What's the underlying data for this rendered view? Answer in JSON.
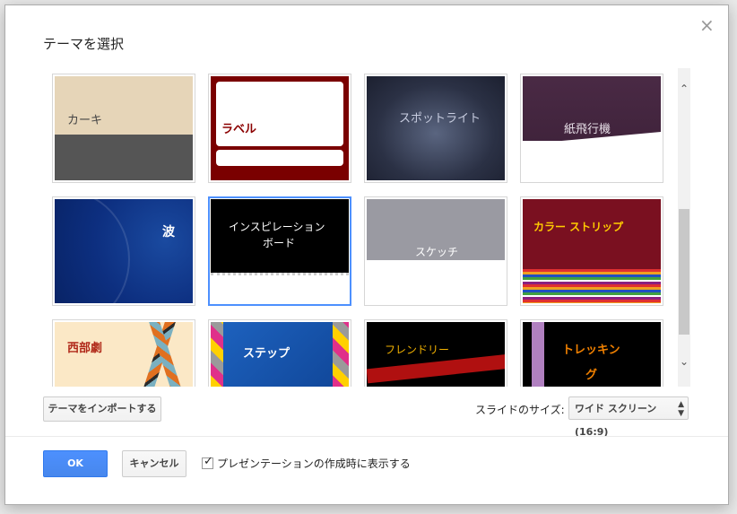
{
  "dialog": {
    "title": "テーマを選択",
    "close_glyph": "×"
  },
  "themes": [
    {
      "name": "カーキ"
    },
    {
      "name": "ラベル"
    },
    {
      "name": "スポットライト"
    },
    {
      "name": "紙飛行機"
    },
    {
      "name": "波"
    },
    {
      "name": "インスピレーション",
      "name2": "ボード",
      "selected": true
    },
    {
      "name": "スケッチ"
    },
    {
      "name": "カラー ストリップ"
    },
    {
      "name": "西部劇"
    },
    {
      "name": "ステップ"
    },
    {
      "name": "フレンドリー"
    },
    {
      "name": "トレッキン",
      "name2": "グ"
    }
  ],
  "scrollbar": {
    "up": "⌃",
    "down": "⌄"
  },
  "import_button": "テーマをインポートする",
  "slide_size": {
    "label": "スライドのサイズ:",
    "value": "ワイド スクリーン(16:9)"
  },
  "ok_button": "OK",
  "cancel_button": "キャンセル",
  "show_on_create": {
    "label": "プレゼンテーションの作成時に表示する",
    "checked": true,
    "check_glyph": "✓"
  }
}
